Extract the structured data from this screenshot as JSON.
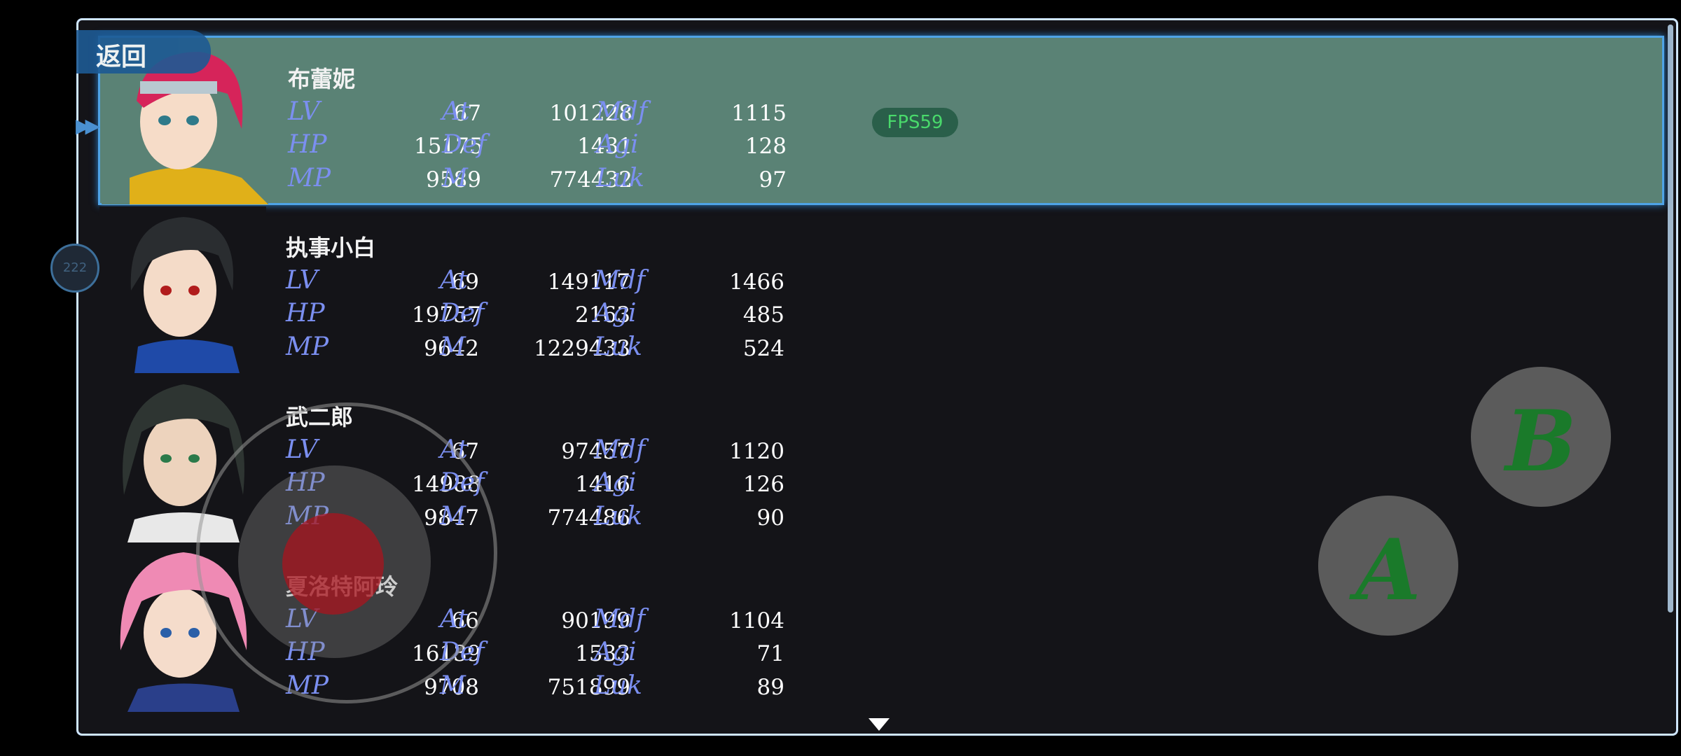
{
  "menu": {
    "back_label": "返回"
  },
  "fps_label": "FPS59",
  "float_ball_label": "222",
  "stat_labels": {
    "lv": "LV",
    "hp": "HP",
    "mp": "MP",
    "atk": "At",
    "def": "Def",
    "mat": "M",
    "mdf": "Mdf",
    "agi": "Agi",
    "luk": "Luk"
  },
  "party": [
    {
      "name": "布蕾妮",
      "lv": "67",
      "hp": "15175",
      "mp": "9589",
      "atk": "101228",
      "def": "1431",
      "mat": "774432",
      "mdf": "1115",
      "agi": "128",
      "luk": "97",
      "selected": true
    },
    {
      "name": "执事小白",
      "lv": "69",
      "hp": "19757",
      "mp": "9642",
      "atk": "149117",
      "def": "2163",
      "mat": "1229433",
      "mdf": "1466",
      "agi": "485",
      "luk": "524",
      "selected": false
    },
    {
      "name": "武二郎",
      "lv": "67",
      "hp": "14988",
      "mp": "9847",
      "atk": "97457",
      "def": "1416",
      "mat": "774486",
      "mdf": "1120",
      "agi": "126",
      "luk": "90",
      "selected": false
    },
    {
      "name": "夏洛特阿玲",
      "lv": "66",
      "hp": "16139",
      "mp": "9708",
      "atk": "90199",
      "def": "1533",
      "mat": "751899",
      "mdf": "1104",
      "agi": "71",
      "luk": "89",
      "selected": false
    }
  ],
  "buttons": {
    "a_label": "A",
    "b_label": "B"
  },
  "colors": {
    "selected_row": "#5a8275",
    "stat_label": "#7b8ff0",
    "fps_text": "#49d96b",
    "action_letter": "#1a7a2a"
  }
}
